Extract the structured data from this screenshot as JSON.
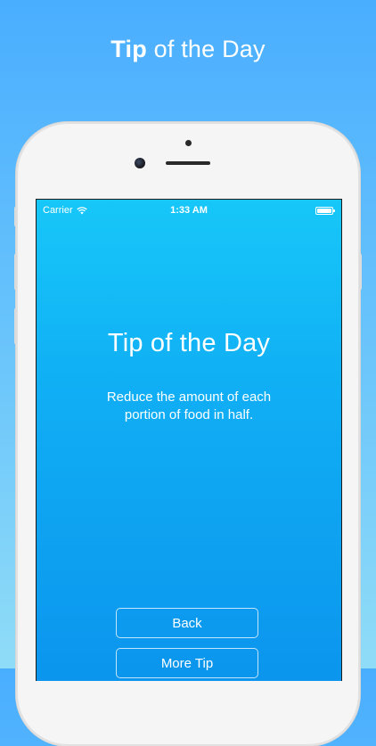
{
  "headline": {
    "bold": "Tip",
    "light": "of the Day"
  },
  "status_bar": {
    "carrier": "Carrier",
    "time": "1:33 AM"
  },
  "screen": {
    "title": "Tip of the Day",
    "tip": "Reduce the amount of each portion of food in half.",
    "back_label": "Back",
    "more_label": "More Tip"
  },
  "colors": {
    "background_top": "#4aaeff",
    "screen_gradient_top": "#17c7f9",
    "screen_gradient_bottom": "#0b95ee",
    "phone_body": "#f5f5f5",
    "text": "#ffffff"
  }
}
